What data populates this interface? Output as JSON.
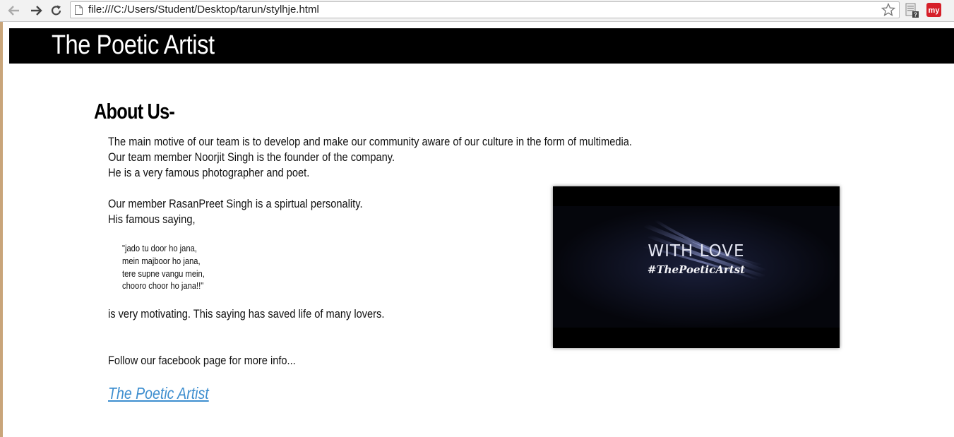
{
  "browser": {
    "url": "file:///C:/Users/Student/Desktop/tarun/stylhje.html",
    "ext_label": "my"
  },
  "site": {
    "title": "The Poetic Artist"
  },
  "about": {
    "heading": "About Us-",
    "lines": [
      "The main motive of our team is to develop and make our community aware of our culture in the form of multimedia.",
      "Our team member Noorjit Singh is the founder of the company.",
      "He is a very famous photographer and poet.",
      "Our member RasanPreet Singh is a spirtual personality.",
      "His famous saying,"
    ],
    "quote": [
      "\"jado tu door ho jana,",
      "mein majboor ho jana,",
      "tere supne vangu mein,",
      "chooro choor ho jana!!\""
    ],
    "after_quote": "is very motivating. This saying has saved life of many lovers.",
    "follow": "Follow our facebook page for more info...",
    "link_text": "The Poetic Artist"
  },
  "video": {
    "line1": "WITH LOVE",
    "line2": "#ThePoeticArtst"
  }
}
